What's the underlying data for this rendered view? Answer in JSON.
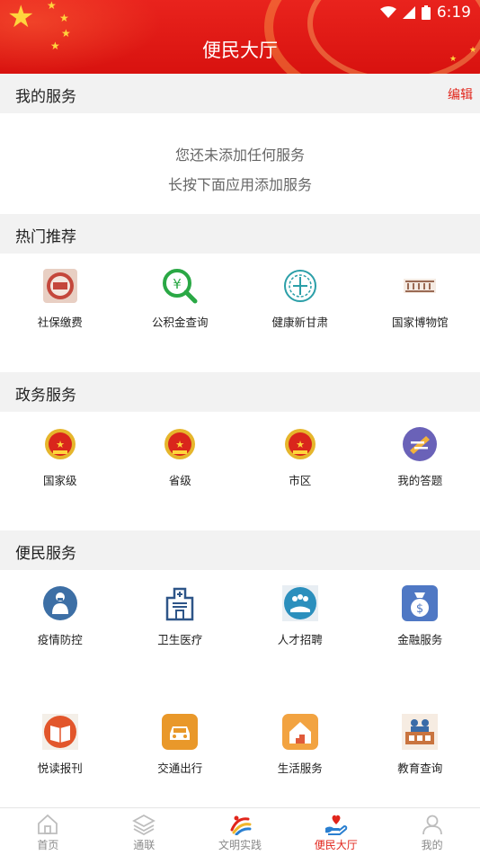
{
  "status_bar": {
    "time": "6:19"
  },
  "header": {
    "title": "便民大厅"
  },
  "my_services": {
    "heading": "我的服务",
    "edit_label": "编辑",
    "empty_line1": "您还未添加任何服务",
    "empty_line2": "长按下面应用添加服务"
  },
  "hot": {
    "heading": "热门推荐",
    "items": [
      {
        "label": "社保缴费",
        "icon": "social-security-icon"
      },
      {
        "label": "公积金查询",
        "icon": "housing-fund-search-icon"
      },
      {
        "label": "健康新甘肃",
        "icon": "health-gansu-icon"
      },
      {
        "label": "国家博物馆",
        "icon": "national-museum-icon"
      }
    ]
  },
  "gov": {
    "heading": "政务服务",
    "items": [
      {
        "label": "国家级",
        "icon": "national-emblem-icon"
      },
      {
        "label": "省级",
        "icon": "national-emblem-icon"
      },
      {
        "label": "市区",
        "icon": "national-emblem-icon"
      },
      {
        "label": "我的答题",
        "icon": "quiz-pencil-icon"
      }
    ]
  },
  "civic": {
    "heading": "便民服务",
    "row1": [
      {
        "label": "疫情防控",
        "icon": "epidemic-control-icon"
      },
      {
        "label": "卫生医疗",
        "icon": "hospital-icon"
      },
      {
        "label": "人才招聘",
        "icon": "recruitment-icon"
      },
      {
        "label": "金融服务",
        "icon": "finance-bag-icon"
      }
    ],
    "row2": [
      {
        "label": "悦读报刊",
        "icon": "reading-book-icon"
      },
      {
        "label": "交通出行",
        "icon": "car-icon"
      },
      {
        "label": "生活服务",
        "icon": "home-icon"
      },
      {
        "label": "教育查询",
        "icon": "education-icon"
      }
    ]
  },
  "tabs": [
    {
      "label": "首页",
      "icon": "home-tab-icon",
      "active": false
    },
    {
      "label": "通联",
      "icon": "layers-icon",
      "active": false
    },
    {
      "label": "文明实践",
      "icon": "civilization-practice-logo-icon",
      "active": false
    },
    {
      "label": "便民大厅",
      "icon": "service-hall-icon",
      "active": true
    },
    {
      "label": "我的",
      "icon": "user-icon",
      "active": false
    }
  ],
  "colors": {
    "brand_red": "#e1251b",
    "section_bg": "#f2f2f2"
  }
}
